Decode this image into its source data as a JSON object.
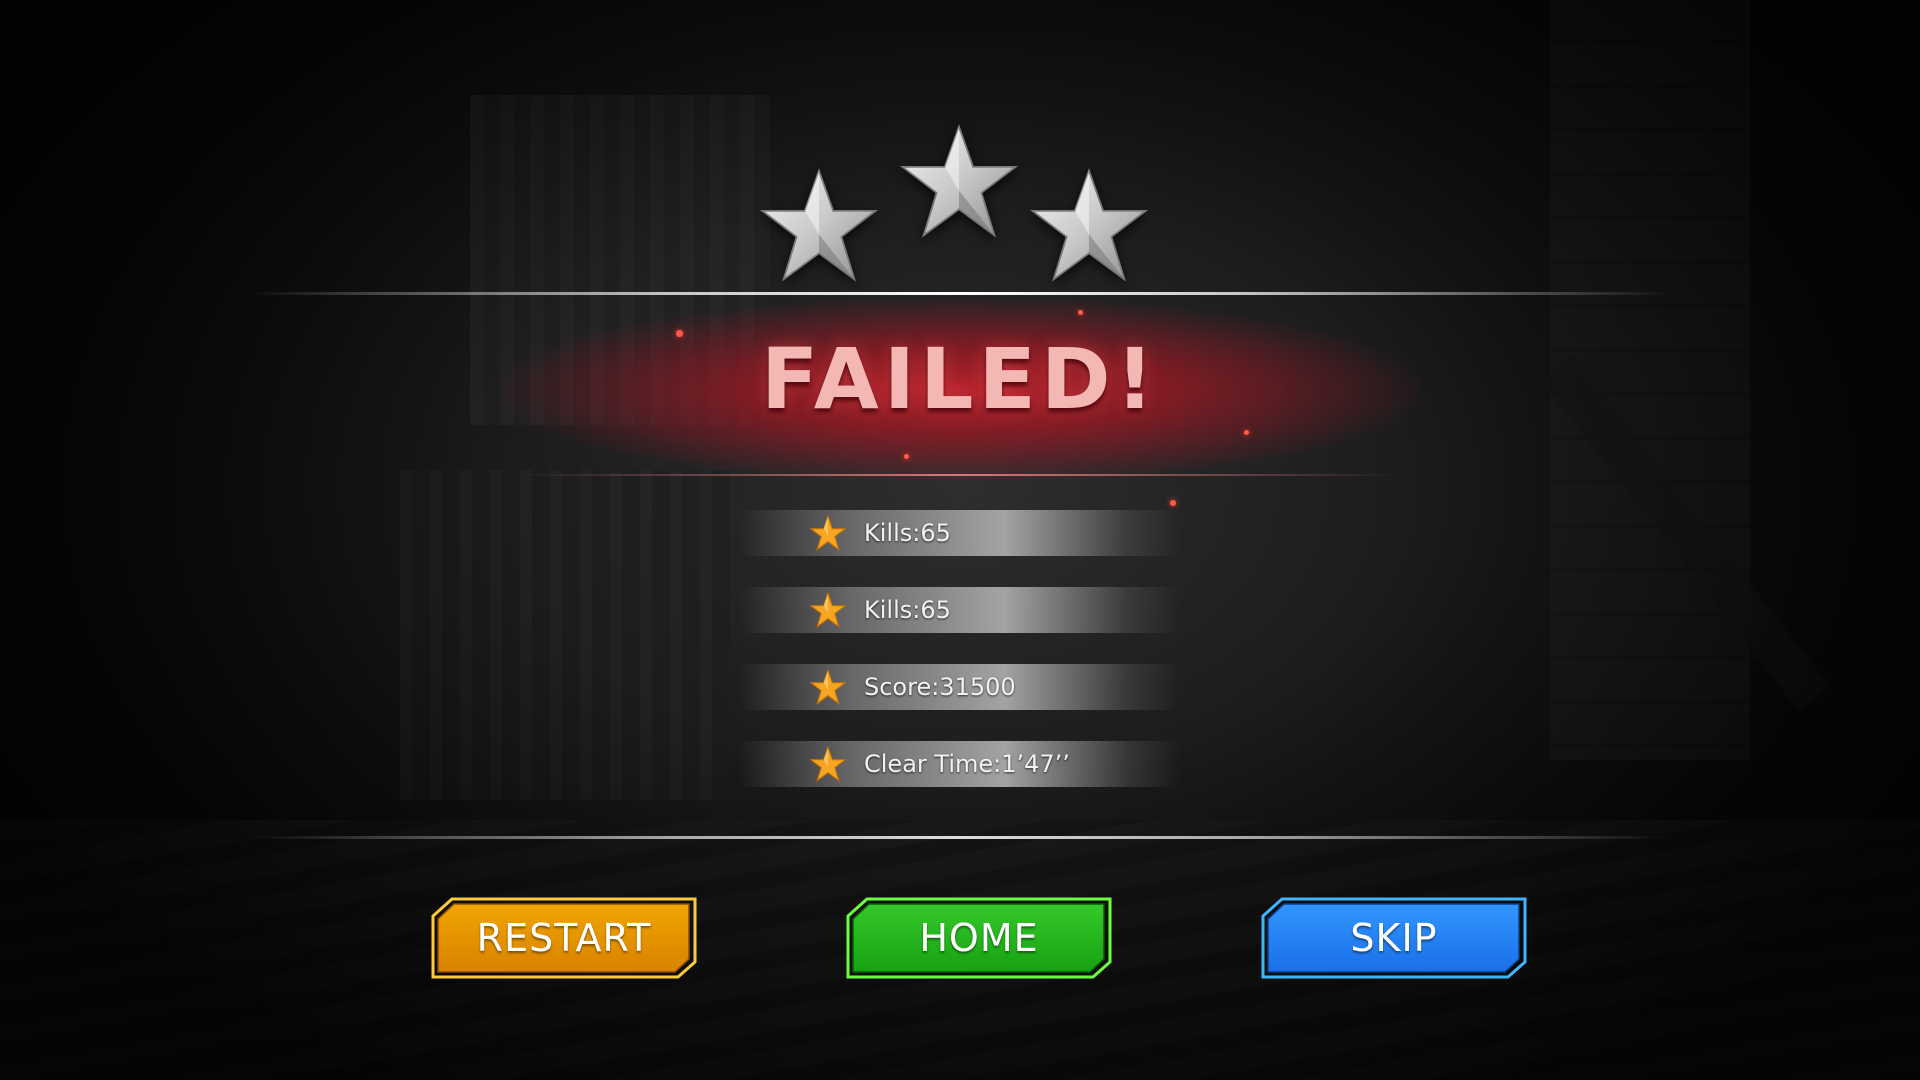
{
  "result": {
    "title": "FAILED!",
    "stars_earned": 0,
    "stars_total": 3
  },
  "stats": [
    {
      "text": "Kills:65",
      "icon": "star-icon"
    },
    {
      "text": "Kills:65",
      "icon": "star-icon"
    },
    {
      "text": "Score:31500",
      "icon": "star-icon"
    },
    {
      "text": "Clear Time:1’47’’",
      "icon": "star-icon"
    }
  ],
  "buttons": {
    "restart": {
      "label": "RESTART",
      "color": "#e39a00"
    },
    "home": {
      "label": "HOME",
      "color": "#22b81a"
    },
    "skip": {
      "label": "SKIP",
      "color": "#1f7fff"
    }
  },
  "colors": {
    "banner_red": "#b52230",
    "title_text": "#f3b7b4",
    "rating_star_empty": "#c8c8c8",
    "stat_star": "#f6a623"
  }
}
